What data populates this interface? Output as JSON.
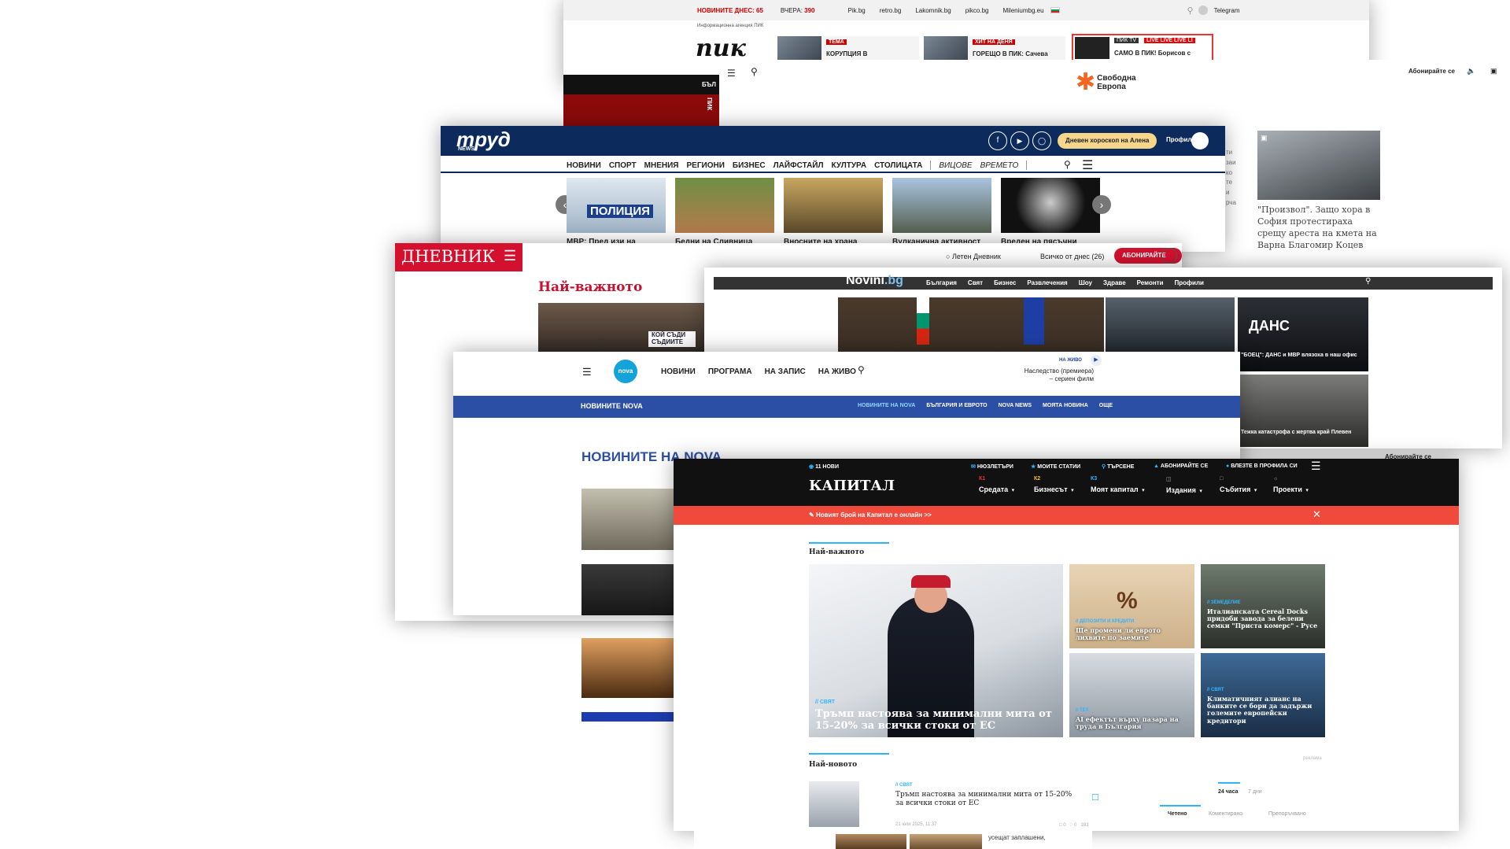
{
  "pik": {
    "top": {
      "today_label": "НОВИНИТЕ ДНЕС:",
      "today_count": "65",
      "yesterday_label": "ВЧЕРА:",
      "yesterday_count": "390",
      "links": [
        "Pik.bg",
        "retro.bg",
        "Lakomnik.bg",
        "pikco.bg",
        "Mileniumbg.eu"
      ],
      "telegram": "Telegram"
    },
    "agency": "Информационна агенция ПИК",
    "logo": "пик",
    "cards": [
      {
        "tag": "ТЕМА",
        "text": "КОРУПЦИЯ В"
      },
      {
        "tag": "ХИТ НА ДЕНЯ",
        "text": "ГОРЕЩО В ПИК: Сачева"
      },
      {
        "tag": "ПИК TV",
        "live": "LIVE   LIVE   LIVE   LI",
        "text": "САМО В ПИК! Борисов с"
      }
    ],
    "band_text": "БЪЛ",
    "red_text": "ПИК"
  },
  "svob": {
    "logo_line1": "Свободна",
    "logo_line2": "Европа",
    "subscribe": "Абонирайте се",
    "subscribe2": "Абонирайте се",
    "side_caption": "\"Произвол\". Защо хора в София протестираха срещу ареста на кмета на Варна Благомир Коцев",
    "side_snippet": "ти\nзаи\nко\nте\nи\nрча"
  },
  "trud": {
    "logo": "труд",
    "logo_sub": "NEWS",
    "horoscope": "Дневен хороскоп на Алена",
    "profile": "Профил",
    "nav": [
      "НОВИНИ",
      "СПОРТ",
      "МНЕНИЯ",
      "РЕГИОНИ",
      "БИЗНЕС",
      "ЛАЙФСТАЙЛ",
      "КУЛТУРА",
      "СТОЛИЦАТА"
    ],
    "nav_italic": [
      "ВИЦОВЕ",
      "ВРЕМЕТО"
    ],
    "slides": [
      "МВР: Пред изи на",
      "Бедни на Сливница",
      "Вносните на храна",
      "Вулканична активност",
      "Вреден на пясъчни"
    ],
    "police_text": "ПОЛИЦИЯ"
  },
  "dnevnik": {
    "logo": "ДНЕВНИК",
    "summer": "Летен Дневник",
    "all_today": "Всичко от днес (26)",
    "subscribe": "АБОНИРАЙТЕ СЕ",
    "heading": "Най-важното",
    "sign": "КОЙ СЪДИ СЪДИИТЕ"
  },
  "novini": {
    "logo": "Novini",
    "logo_tld": ".bg",
    "nav": [
      "България",
      "Свят",
      "Бизнес",
      "Развлечения",
      "Шоу",
      "Здраве",
      "Ремонти",
      "Профили"
    ],
    "card1_title": "ДАНС",
    "card1_caption": "\"БОЕЦ\": ДАНС и МВР влязоха в наш офис",
    "card2_caption": "Тежка катастрофа с жертва край Плевен"
  },
  "nova": {
    "nav": [
      "НОВИНИ",
      "ПРОГРАМА",
      "НА ЗАПИС",
      "НА ЖИВО"
    ],
    "logo": "nova",
    "live_label": "НА ЖИВО",
    "live_show": "Наследство (премиера)\n– сериен филм",
    "subnav": [
      "НОВИНИТЕ НА NOVA",
      "БЪЛГАРИЯ И ЕВРОТО",
      "NOVA NEWS",
      "МОЯТА НОВИНА",
      "ОЩЕ"
    ],
    "subbrand": "НОВИНИТЕ NOVA",
    "heading": "НОВИНИТЕ НА NOVA"
  },
  "kap": {
    "top": {
      "brand": "11 НОВИ",
      "newsletters": "НЮЗЛЕТЪРИ",
      "my": "МОИТЕ СТАТИИ",
      "search": "ТЪРСЕНЕ",
      "subscribe": "АБОНИРАЙТЕ СЕ",
      "profile": "ВЛЕЗТЕ В ПРОФИЛА СИ"
    },
    "logo": "КАПИТАЛ",
    "nav": [
      {
        "k": "К1",
        "label": "Средата"
      },
      {
        "k": "К2",
        "label": "Бизнесът"
      },
      {
        "k": "К3",
        "label": "Моят капитал"
      },
      {
        "k": "",
        "label": "Издания"
      },
      {
        "k": "",
        "label": "Събития"
      },
      {
        "k": "",
        "label": "Проекти"
      }
    ],
    "banner": "Новият брой на Капитал е онлайн >>",
    "section1": "Най-важното",
    "hero_tag": "// СВЯТ",
    "hero_title": "Тръмп настоява за минимални мита от 15-20% за всички стоки от ЕС",
    "cards": [
      {
        "tag": "// ДЕПОЗИТИ И КРЕДИТИ",
        "title": "Ще промени ли еврото лихвите по заемите"
      },
      {
        "tag": "// ЗЕМЕДЕЛИЕ",
        "title": "Италианската Cereal Docks придоби завода за белени семки \"Приста комерс\" - Русе"
      },
      {
        "tag": "// ТЕХ",
        "title": "AI ефектът върху пазара на труда в България"
      },
      {
        "tag": "// СВЯТ",
        "title": "Климатичният алианс на банките се бори да задържи големите европейски кредитори"
      }
    ],
    "section2": "Най-новото",
    "ad": "реклама",
    "latest": {
      "tag": "// СВЯТ",
      "title": "Тръмп настоява за минимални мита от 15-20% за всички стоки от ЕС",
      "time": "21 юли 2025, 11:37",
      "comments": "0",
      "likes": "0",
      "views": "193"
    },
    "tabs_top": [
      "24 часа",
      "7 дни"
    ],
    "tabs": [
      "Четено",
      "Коментирано",
      "Препоръчвано"
    ],
    "bottom_snippet": "усещат заплашени,"
  }
}
